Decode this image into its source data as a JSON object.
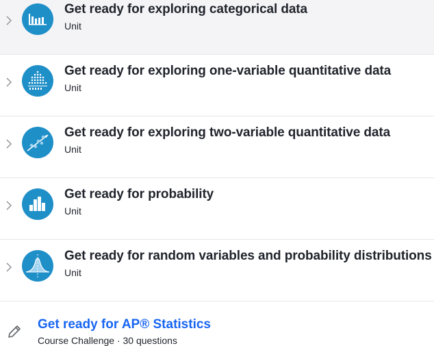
{
  "units": [
    {
      "title": "Get ready for exploring categorical data",
      "subtitle": "Unit",
      "icon": "bar-chart-icon"
    },
    {
      "title": "Get ready for exploring one-variable quantitative data",
      "subtitle": "Unit",
      "icon": "dot-plot-icon"
    },
    {
      "title": "Get ready for exploring two-variable quantitative data",
      "subtitle": "Unit",
      "icon": "scatter-plot-icon"
    },
    {
      "title": "Get ready for probability",
      "subtitle": "Unit",
      "icon": "histogram-icon"
    },
    {
      "title": "Get ready for random variables and probability distributions",
      "subtitle": "Unit",
      "icon": "normal-curve-icon"
    }
  ],
  "challenge": {
    "title": "Get ready for AP® Statistics",
    "subtitle": "Course Challenge · 30 questions",
    "icon": "pencil-icon"
  },
  "colors": {
    "icon_bg": "#1f8fc8",
    "link": "#1865f2",
    "text": "#21242c",
    "active_row": "#f4f4f6",
    "divider": "#e6e6e8"
  }
}
